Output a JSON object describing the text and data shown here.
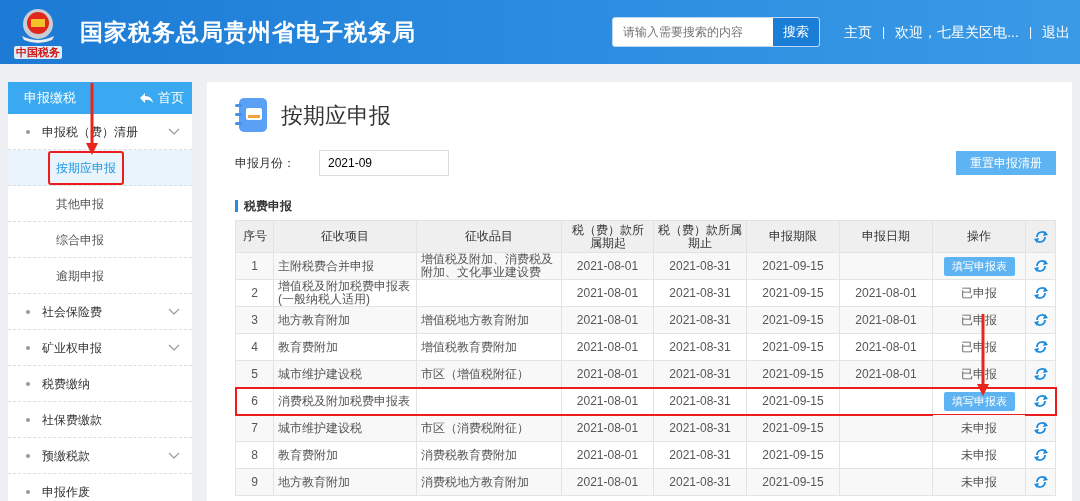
{
  "header": {
    "logo_caption": "中国税务",
    "title": "国家税务总局贵州省电子税务局",
    "search": {
      "placeholder": "请输入需要搜索的内容",
      "button": "搜索"
    },
    "links": [
      "主页",
      "欢迎，七星关区电...",
      "退出"
    ],
    "link_separator": "|"
  },
  "sidebar": {
    "title": "申报缴税",
    "home_link": "首页",
    "items": [
      {
        "label": "申报税（费）清册",
        "expandable": true,
        "children": [
          {
            "label": "按期应申报",
            "selected": true,
            "highlighted": true
          },
          {
            "label": "其他申报",
            "selected": false,
            "highlighted": false
          },
          {
            "label": "综合申报",
            "selected": false,
            "highlighted": false
          },
          {
            "label": "逾期申报",
            "selected": false,
            "highlighted": false
          }
        ]
      },
      {
        "label": "社会保险费",
        "expandable": true
      },
      {
        "label": "矿业权申报",
        "expandable": true
      },
      {
        "label": "税费缴纳",
        "expandable": false
      },
      {
        "label": "社保费缴款",
        "expandable": false
      },
      {
        "label": "预缴税款",
        "expandable": true
      },
      {
        "label": "申报作废",
        "expandable": false
      }
    ]
  },
  "page": {
    "title": "按期应申报",
    "month_label": "申报月份：",
    "month_value": "2021-09",
    "reset_button": "重置申报清册",
    "section_title": "税费申报"
  },
  "table": {
    "columns": [
      "序号",
      "征收项目",
      "征收品目",
      "税（费）款所属期起",
      "税（费）款所属期止",
      "申报期限",
      "申报日期",
      "操作"
    ],
    "rows": [
      {
        "no": "1",
        "item": "主附税费合并申报",
        "subitem": "增值税及附加、消费税及附加、文化事业建设费",
        "start": "2021-08-01",
        "end": "2021-08-31",
        "deadline": "2021-09-15",
        "filed": "",
        "action": {
          "kind": "button",
          "label": "填写申报表"
        },
        "highlighted": false
      },
      {
        "no": "2",
        "item": "增值税及附加税费申报表(一般纳税人适用)",
        "subitem": "",
        "start": "2021-08-01",
        "end": "2021-08-31",
        "deadline": "2021-09-15",
        "filed": "2021-08-01",
        "action": {
          "kind": "text",
          "label": "已申报"
        },
        "highlighted": false
      },
      {
        "no": "3",
        "item": "地方教育附加",
        "subitem": "增值税地方教育附加",
        "start": "2021-08-01",
        "end": "2021-08-31",
        "deadline": "2021-09-15",
        "filed": "2021-08-01",
        "action": {
          "kind": "text",
          "label": "已申报"
        },
        "highlighted": false
      },
      {
        "no": "4",
        "item": "教育费附加",
        "subitem": "增值税教育费附加",
        "start": "2021-08-01",
        "end": "2021-08-31",
        "deadline": "2021-09-15",
        "filed": "2021-08-01",
        "action": {
          "kind": "text",
          "label": "已申报"
        },
        "highlighted": false
      },
      {
        "no": "5",
        "item": "城市维护建设税",
        "subitem": "市区（增值税附征）",
        "start": "2021-08-01",
        "end": "2021-08-31",
        "deadline": "2021-09-15",
        "filed": "2021-08-01",
        "action": {
          "kind": "text",
          "label": "已申报"
        },
        "highlighted": false
      },
      {
        "no": "6",
        "item": "消费税及附加税费申报表",
        "subitem": "",
        "start": "2021-08-01",
        "end": "2021-08-31",
        "deadline": "2021-09-15",
        "filed": "",
        "action": {
          "kind": "button",
          "label": "填写申报表"
        },
        "highlighted": true
      },
      {
        "no": "7",
        "item": "城市维护建设税",
        "subitem": "市区（消费税附征）",
        "start": "2021-08-01",
        "end": "2021-08-31",
        "deadline": "2021-09-15",
        "filed": "",
        "action": {
          "kind": "text",
          "label": "未申报"
        },
        "highlighted": false
      },
      {
        "no": "8",
        "item": "教育费附加",
        "subitem": "消费税教育费附加",
        "start": "2021-08-01",
        "end": "2021-08-31",
        "deadline": "2021-09-15",
        "filed": "",
        "action": {
          "kind": "text",
          "label": "未申报"
        },
        "highlighted": false
      },
      {
        "no": "9",
        "item": "地方教育附加",
        "subitem": "消费税地方教育附加",
        "start": "2021-08-01",
        "end": "2021-08-31",
        "deadline": "2021-09-15",
        "filed": "",
        "action": {
          "kind": "text",
          "label": "未申报"
        },
        "highlighted": false
      }
    ]
  }
}
